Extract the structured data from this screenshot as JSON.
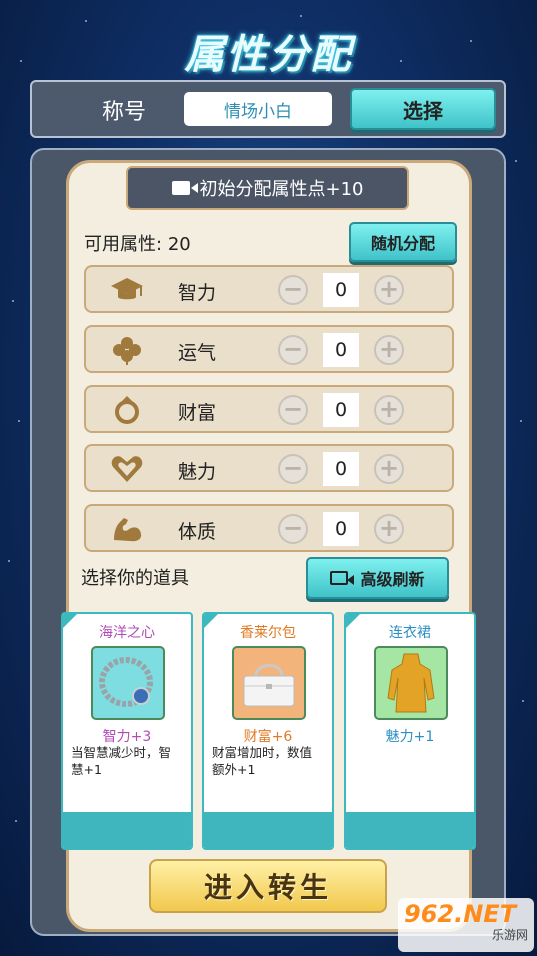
{
  "title": "属性分配",
  "nickname": {
    "label": "称号",
    "value": "情场小白",
    "select_button": "选择"
  },
  "initial_allocate_button": "初始分配属性点+10",
  "available": {
    "label": "可用属性:",
    "value": 20
  },
  "random_button": "随机分配",
  "attributes": [
    {
      "name": "智力",
      "value": 0,
      "icon": "graduation-cap-icon"
    },
    {
      "name": "运气",
      "value": 0,
      "icon": "clover-icon"
    },
    {
      "name": "财富",
      "value": 0,
      "icon": "ring-icon"
    },
    {
      "name": "魅力",
      "value": 0,
      "icon": "heart-icon"
    },
    {
      "name": "体质",
      "value": 0,
      "icon": "muscle-arm-icon"
    }
  ],
  "stepper": {
    "minus": "−",
    "plus": "+"
  },
  "items_label": "选择你的道具",
  "refresh_button": "高级刷新",
  "items": [
    {
      "name": "海洋之心",
      "bonus": "智力+3",
      "desc": "当智慧减少时，智慧+1",
      "name_color": "#b24ab8",
      "bonus_color": "#b24ab8",
      "image": "bracelet-image"
    },
    {
      "name": "香莱尔包",
      "bonus": "财富+6",
      "desc": "财富增加时，数值额外+1",
      "name_color": "#e07a24",
      "bonus_color": "#e07a24",
      "image": "handbag-image"
    },
    {
      "name": "连衣裙",
      "bonus": "魅力+1",
      "desc": "",
      "name_color": "#2b8fc4",
      "bonus_color": "#2b8fc4",
      "image": "dress-image"
    }
  ],
  "rebirth_button": "进入转生",
  "watermark": {
    "number": "962.NET",
    "sub": "乐游网"
  },
  "colors": {
    "accent_teal": "#3fc3c9",
    "gold": "#f1c84d",
    "panel_cream": "#f4eee1"
  }
}
